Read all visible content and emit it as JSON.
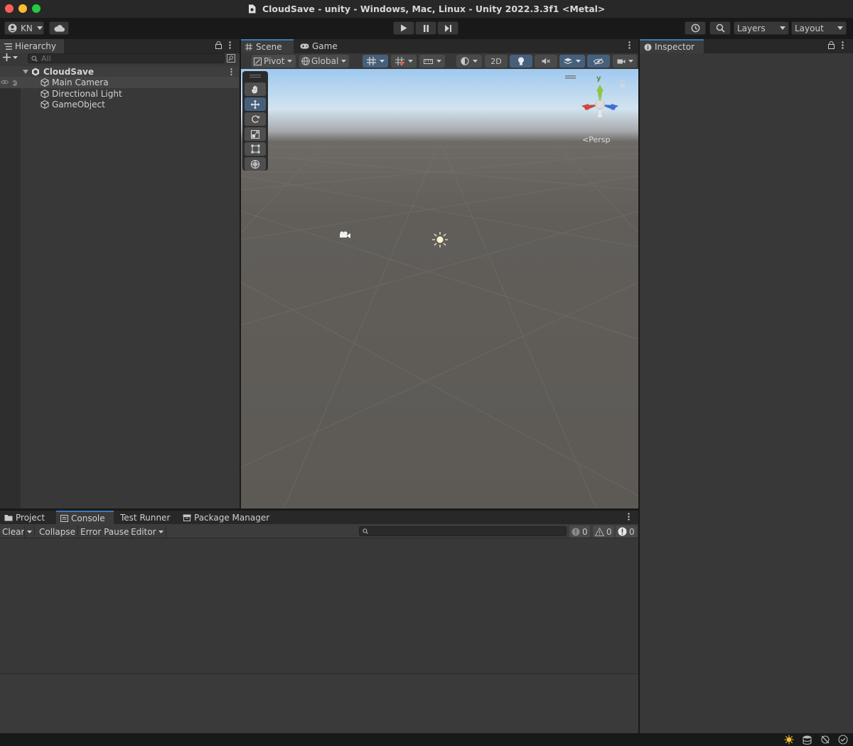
{
  "window": {
    "title": "CloudSave - unity - Windows, Mac, Linux - Unity 2022.3.3f1 <Metal>"
  },
  "toolbar": {
    "account_label": "KN",
    "layers_label": "Layers",
    "layout_label": "Layout"
  },
  "hierarchy": {
    "tab_label": "Hierarchy",
    "search_placeholder": "All",
    "scene_name": "CloudSave",
    "items": [
      {
        "label": "Main Camera"
      },
      {
        "label": "Directional Light"
      },
      {
        "label": "GameObject"
      }
    ]
  },
  "scene_view": {
    "tabs": [
      {
        "label": "Scene",
        "active": true
      },
      {
        "label": "Game",
        "active": false
      }
    ],
    "pivot_label": "Pivot",
    "global_label": "Global",
    "mode_2d_label": "2D",
    "projection_label": "Persp",
    "gizmo_axis_label": "y"
  },
  "inspector": {
    "tab_label": "Inspector"
  },
  "bottom_panel": {
    "tabs": [
      {
        "label": "Project",
        "active": false
      },
      {
        "label": "Console",
        "active": true
      },
      {
        "label": "Test Runner",
        "active": false
      },
      {
        "label": "Package Manager",
        "active": false
      }
    ],
    "console": {
      "clear_label": "Clear",
      "collapse_label": "Collapse",
      "error_pause_label": "Error Pause",
      "editor_label": "Editor",
      "info_count": "0",
      "warning_count": "0",
      "error_count": "0"
    }
  },
  "colors": {
    "accent": "#3a79bb",
    "panel": "#383838",
    "background": "#191919",
    "sky_top": "#9fc9ef",
    "ground": "#5f5c58"
  }
}
